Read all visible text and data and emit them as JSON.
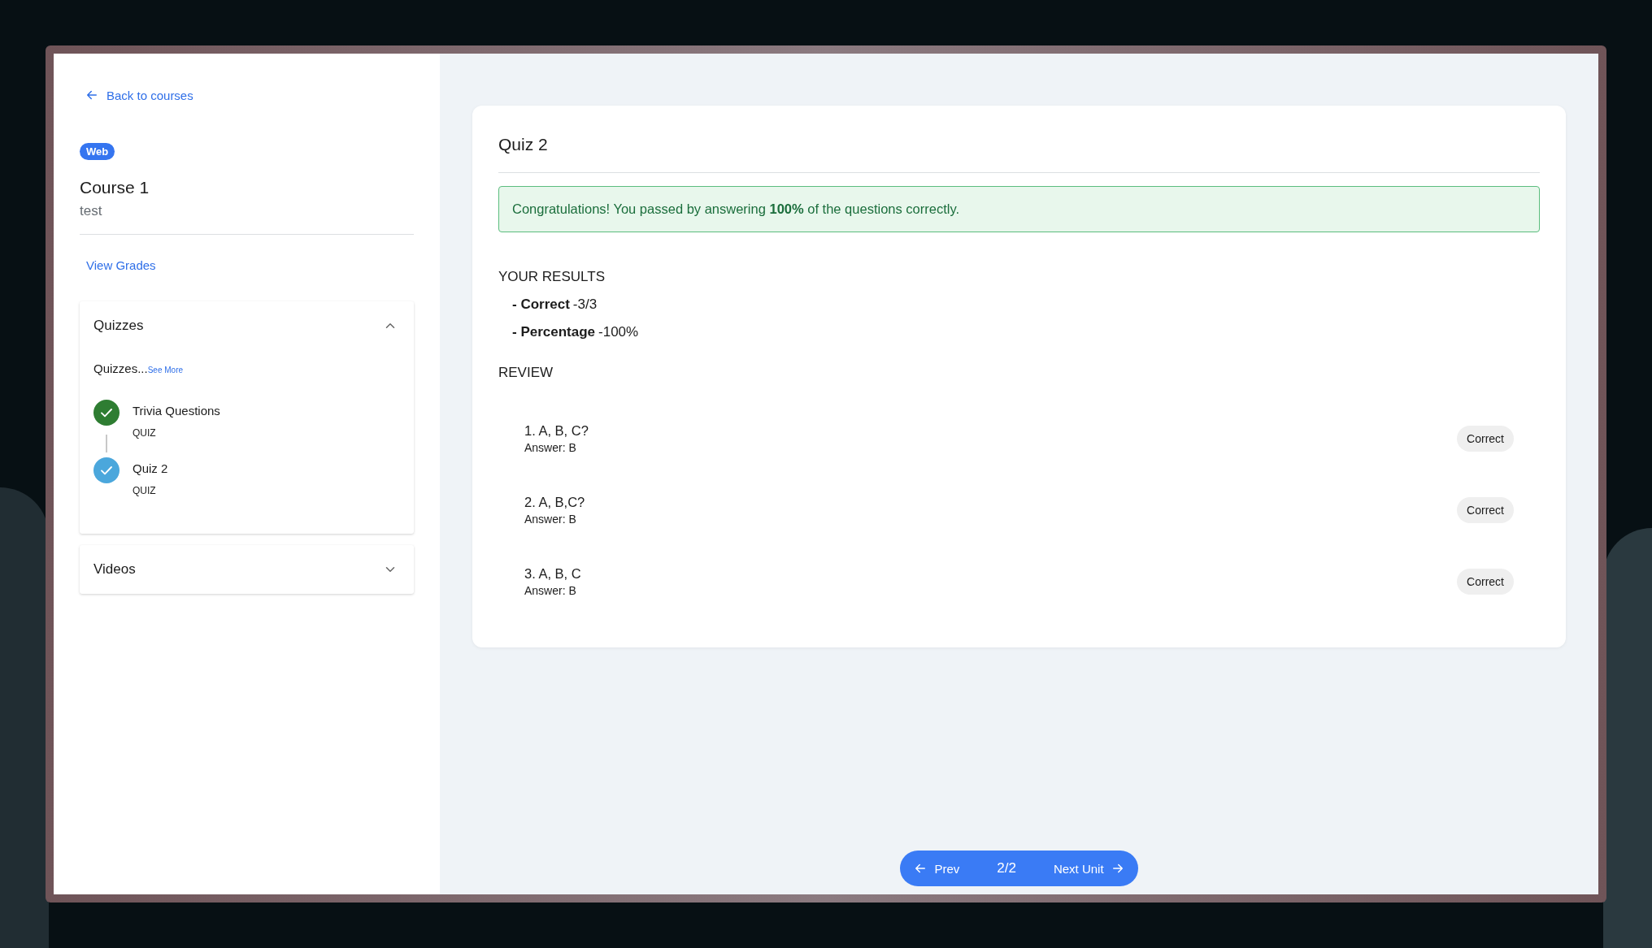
{
  "sidebar": {
    "back_link": "Back to courses",
    "tag": "Web",
    "course_title": "Course 1",
    "course_subtitle": "test",
    "grades_link": "View Grades",
    "sections": [
      {
        "title": "Quizzes",
        "expanded": true,
        "description": "Quizzes...",
        "see_more": "See More",
        "items": [
          {
            "title": "Trivia Questions",
            "type": "QUIZ",
            "color": "#2e7d32"
          },
          {
            "title": "Quiz 2",
            "type": "QUIZ",
            "color": "#4ba7dc"
          }
        ]
      },
      {
        "title": "Videos",
        "expanded": false
      }
    ]
  },
  "quiz": {
    "title": "Quiz 2",
    "alert": "Congratulations! You passed by answering **100%** of the questions correctly.",
    "results_heading": "YOUR RESULTS",
    "results": [
      {
        "label": "- Correct",
        "value": "-3/3"
      },
      {
        "label": "- Percentage",
        "value": "-100%"
      }
    ],
    "review_heading": "REVIEW",
    "review": [
      {
        "question": "1. A, B, C?",
        "answer": "Answer: B",
        "result": "Correct"
      },
      {
        "question": "2. A, B,C?",
        "answer": "Answer: B",
        "result": "Correct"
      },
      {
        "question": "3. A, B, C",
        "answer": "Answer: B",
        "result": "Correct"
      }
    ]
  },
  "pager": {
    "prev": "Prev",
    "position": "2/2",
    "next": "Next Unit"
  }
}
